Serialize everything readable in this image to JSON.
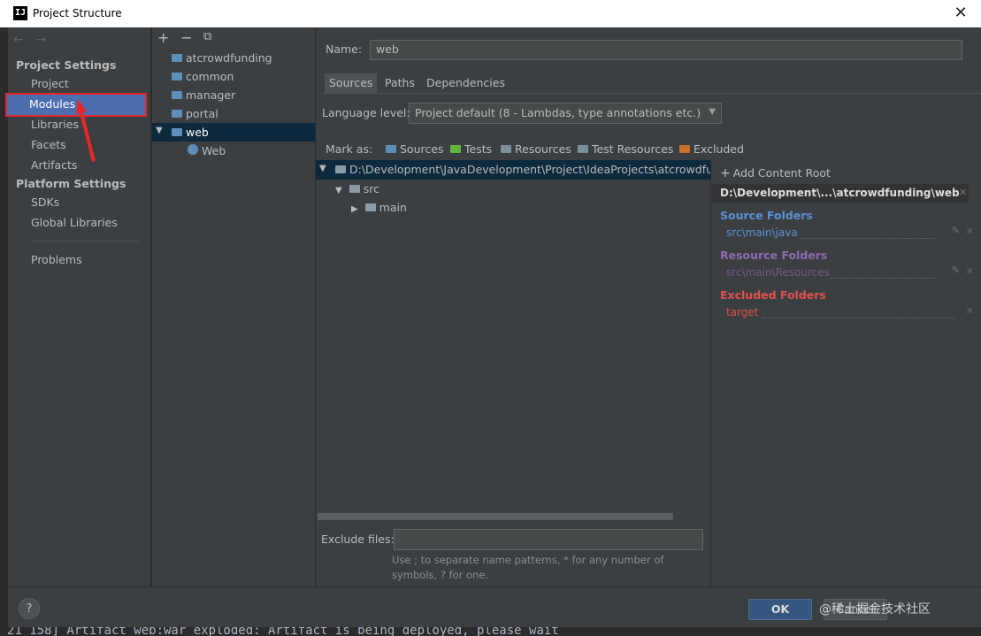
{
  "window": {
    "title": "Project Structure",
    "app_icon": "IJ",
    "close": "✕"
  },
  "nav": {
    "back": "←",
    "forward": "→"
  },
  "sidebar": {
    "project_settings_heading": "Project Settings",
    "project_settings_items": [
      "Project",
      "Modules",
      "Libraries",
      "Facets",
      "Artifacts"
    ],
    "selected": "Modules",
    "platform_settings_heading": "Platform Settings",
    "platform_settings_items": [
      "SDKs",
      "Global Libraries"
    ],
    "problems": "Problems"
  },
  "module_tree": {
    "toolbar": {
      "add": "+",
      "remove": "−",
      "copy": "⧉"
    },
    "items": [
      "atcrowdfunding",
      "common",
      "manager",
      "portal",
      "web"
    ],
    "selected": "web",
    "child_facet": "Web"
  },
  "module_details": {
    "name_label": "Name:",
    "name_value": "web",
    "tabs": [
      "Sources",
      "Paths",
      "Dependencies"
    ],
    "active_tab": "Sources",
    "language_level_label": "Language level:",
    "language_level_value": "Project default (8 - Lambdas, type annotations etc.)",
    "mark_as_label": "Mark as:",
    "mark_as_buttons": [
      "Sources",
      "Tests",
      "Resources",
      "Test Resources",
      "Excluded"
    ],
    "root_path": "D:\\Development\\JavaDevelopment\\Project\\IdeaProjects\\atcrowdfundi",
    "tree": [
      "src",
      "main"
    ],
    "exclude_files_label": "Exclude files:",
    "exclude_files_value": "",
    "exclude_hint_line1": "Use ; to separate name patterns, * for any number of",
    "exclude_hint_line2": "symbols, ? for one."
  },
  "content_root": {
    "add_label": "Add Content Root",
    "root_title": "D:\\Development\\...\\atcrowdfunding\\web",
    "source_heading": "Source Folders",
    "source_entry": "src\\main\\java",
    "resource_heading": "Resource Folders",
    "resource_entry": "src\\main\\Resources",
    "excluded_heading": "Excluded Folders",
    "excluded_entry": "target",
    "colors": {
      "source": "#5a8fd6",
      "resource": "#8e6bb0",
      "excluded": "#e0504f"
    }
  },
  "footer": {
    "help": "?",
    "ok": "OK",
    "cancel": "Cancel",
    "watermark": "@稀土掘金技术社区"
  },
  "background_console": "21 158] Artifact web:war exploded: Artifact is being deployed, please wait"
}
